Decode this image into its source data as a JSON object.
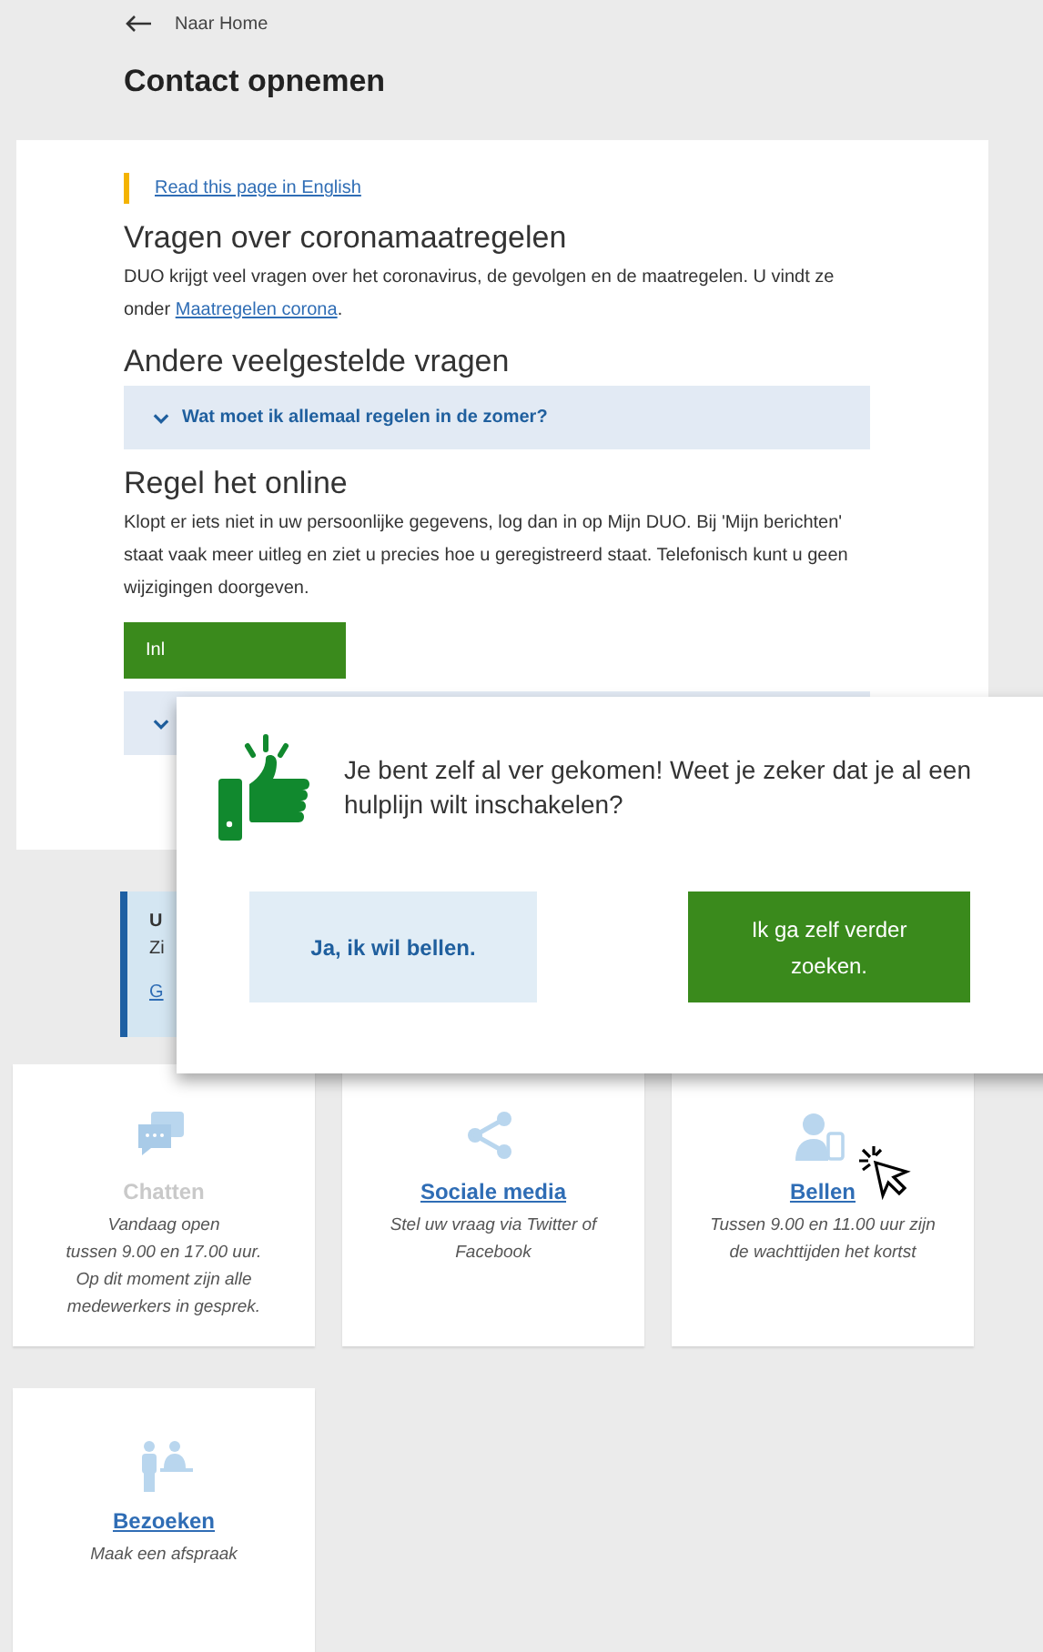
{
  "back_link": "Naar Home",
  "title": "Contact opnemen",
  "language_link": "Read this page in English",
  "sections": [
    {
      "heading": "Vragen over coronamaatregelen",
      "text": "DUO krijgt veel vragen over het coronavirus, de gevolgen en de maatregelen. U vindt ze onder ",
      "link": "Maatregelen corona",
      "after": "."
    },
    {
      "heading": "Andere veelgestelde vragen",
      "accordion": "Wat moet ik allemaal regelen in de zomer?"
    },
    {
      "heading": "Regel het online",
      "text": "Klopt er iets niet in uw persoonlijke gegevens, log dan in op Mijn DUO. Bij 'Mijn berichten' staat vaak meer uitleg en ziet u precies hoe u geregistreerd staat. Telefonisch kunt u geen wijzigingen doorgeven.",
      "button": "Inl"
    }
  ],
  "info_box": {
    "title": "U",
    "text": "Zi",
    "link": "G"
  },
  "tiles": [
    {
      "kind": "chat",
      "title": "Chatten",
      "disabled": true,
      "text": "Vandaag open\ntussen 9.00 en 17.00 uur.\nOp dit moment zijn alle\nmedewerkers in gesprek."
    },
    {
      "kind": "share",
      "title": "Sociale media",
      "disabled": false,
      "text": "Stel uw vraag via Twitter of\nFacebook"
    },
    {
      "kind": "phone",
      "title": "Bellen",
      "disabled": false,
      "text": "Tussen 9.00 en 11.00 uur zijn\nde wachttijden het kortst"
    },
    {
      "kind": "visit",
      "title": "Bezoeken",
      "disabled": false,
      "text": "Maak een afspraak"
    }
  ],
  "dialog": {
    "message": "Je bent zelf al ver gekomen! Weet je zeker dat je al een hulplijn wilt inschakelen?",
    "buttons": [
      {
        "label": "Ja, ik wil bellen.",
        "kind": "secondary"
      },
      {
        "label": "Ik ga zelf verder zoeken.",
        "kind": "primary"
      }
    ]
  }
}
